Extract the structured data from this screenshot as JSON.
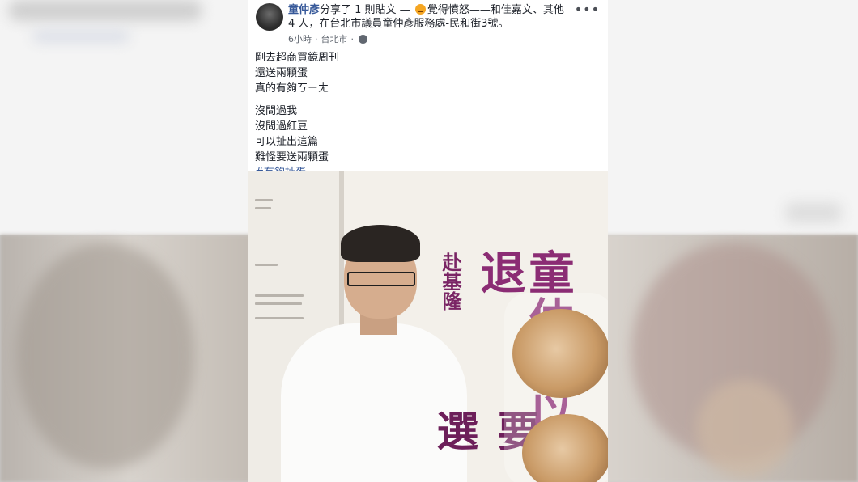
{
  "post": {
    "author": "童仲彥",
    "header_text": "分享了 1 則貼文 —",
    "feeling": "覺得憤怒——和",
    "tagged": "佳嘉文、其他 4 人",
    "location_prefix": "，在",
    "location": "台北市議員童仲彥服務處-民和街3號",
    "location_suffix": "。",
    "time": "6小時",
    "place": "台北市",
    "more_label": "•••",
    "body_lines_1": [
      "剛去超商買鏡周刊",
      "還送兩顆蛋",
      "真的有夠ㄎㄧㄤ"
    ],
    "body_lines_2": [
      "沒問過我",
      "沒問過紅豆",
      "可以扯出這篇",
      "難怪要送兩顆蛋"
    ],
    "hashtag": "#有夠扯蛋"
  },
  "photo": {
    "headline_main": "童仲彥以退",
    "headline_sub": "赴基隆",
    "headline_big": "要選"
  },
  "icons": {
    "avatar": "avatar",
    "feeling": "angry-face-icon",
    "globe": "globe-icon",
    "more": "more-options-icon"
  }
}
